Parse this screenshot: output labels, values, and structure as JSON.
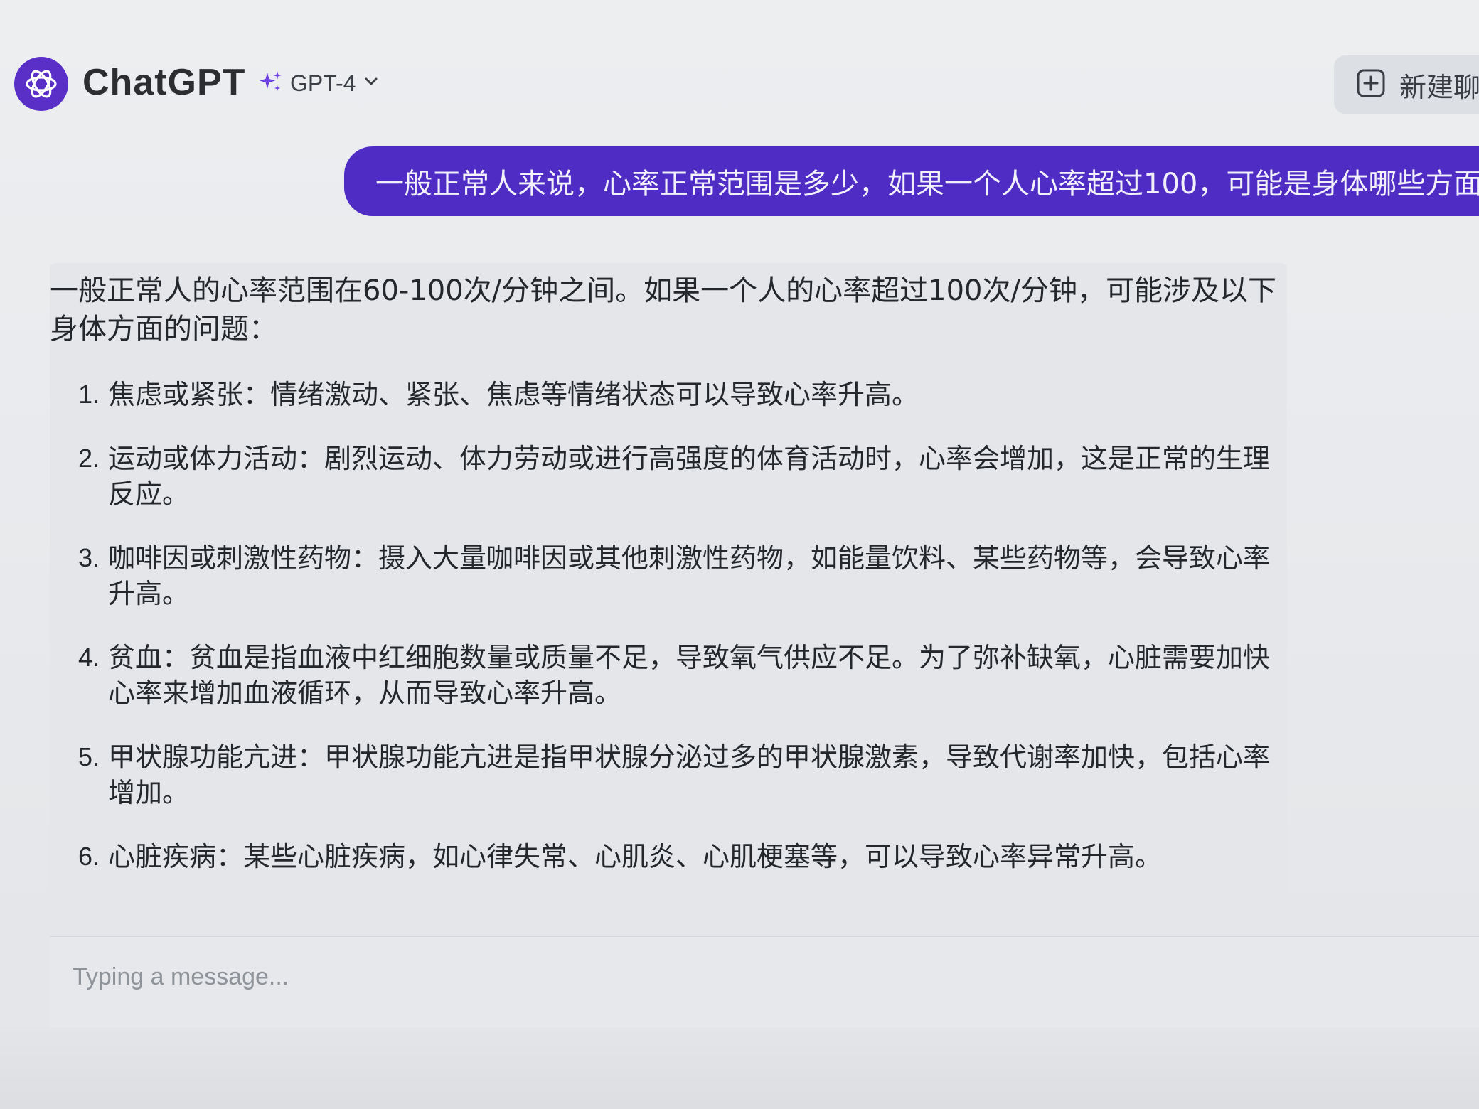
{
  "header": {
    "app_title": "ChatGPT",
    "model_name": "GPT-4",
    "new_chat_label": "新建聊天"
  },
  "user_message": "一般正常人来说，心率正常范围是多少，如果一个人心率超过100，可能是身体哪些方面出现问题",
  "assistant": {
    "intro": "一般正常人的心率范围在60-100次/分钟之间。如果一个人的心率超过100次/分钟，可能涉及以下身体方面的问题：",
    "items": [
      {
        "num": "1.",
        "text": "焦虑或紧张：情绪激动、紧张、焦虑等情绪状态可以导致心率升高。"
      },
      {
        "num": "2.",
        "text": "运动或体力活动：剧烈运动、体力劳动或进行高强度的体育活动时，心率会增加，这是正常的生理反应。"
      },
      {
        "num": "3.",
        "text": "咖啡因或刺激性药物：摄入大量咖啡因或其他刺激性药物，如能量饮料、某些药物等，会导致心率升高。"
      },
      {
        "num": "4.",
        "text": "贫血：贫血是指血液中红细胞数量或质量不足，导致氧气供应不足。为了弥补缺氧，心脏需要加快心率来增加血液循环，从而导致心率升高。"
      },
      {
        "num": "5.",
        "text": "甲状腺功能亢进：甲状腺功能亢进是指甲状腺分泌过多的甲状腺激素，导致代谢率加快，包括心率增加。"
      },
      {
        "num": "6.",
        "text": "心脏疾病：某些心脏疾病，如心律失常、心肌炎、心肌梗塞等，可以导致心率异常升高。"
      }
    ]
  },
  "composer": {
    "placeholder": "Typing a message..."
  },
  "colors": {
    "accent": "#4f2cc4",
    "logo_bg": "#5a2fc8",
    "sparkle": "#6b3fe0"
  },
  "icons": {
    "logo": "openai-logo-icon",
    "model": "sparkle-icon",
    "dropdown": "chevron-down-icon",
    "new_chat": "plus-square-icon"
  }
}
